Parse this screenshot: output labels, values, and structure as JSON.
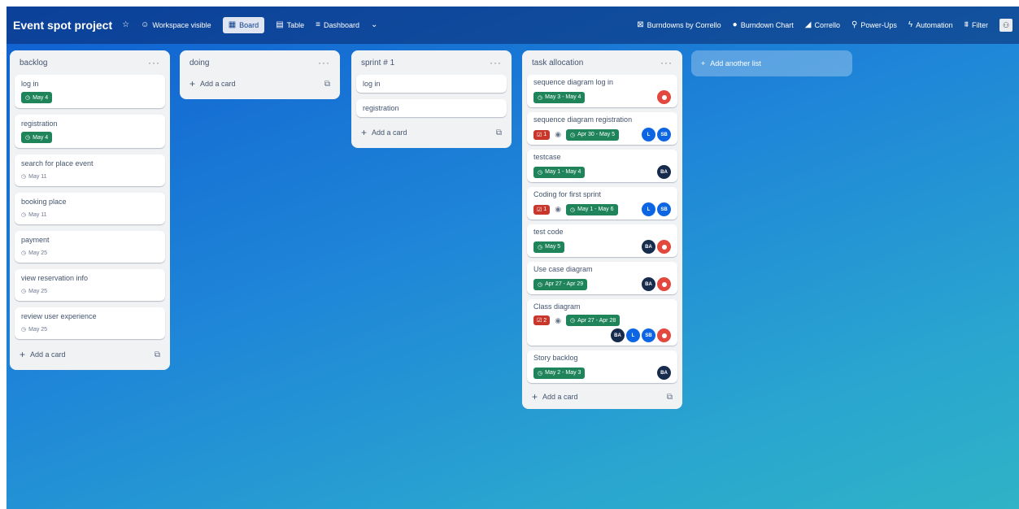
{
  "topbar": {
    "title": "Event spot project",
    "visibility": "Workspace visible",
    "views": {
      "board": "Board",
      "table": "Table",
      "dashboard": "Dashboard"
    },
    "right": {
      "burndowns": "Burndowns by Corrello",
      "burndown_chart": "Burndown Chart",
      "corrello": "Corrello",
      "powerups": "Power-Ups",
      "automation": "Automation",
      "filter": "Filter"
    }
  },
  "lists": [
    {
      "title": "backlog",
      "add_card": "Add a card",
      "cards": [
        {
          "title": "log in",
          "date": "May 4",
          "date_style": "green"
        },
        {
          "title": "registration",
          "date": "May 4",
          "date_style": "green"
        },
        {
          "title": "search for place event",
          "date": "May 11",
          "date_style": "plain"
        },
        {
          "title": "booking place",
          "date": "May 11",
          "date_style": "plain"
        },
        {
          "title": "payment",
          "date": "May 25",
          "date_style": "plain"
        },
        {
          "title": "view reservation info",
          "date": "May 25",
          "date_style": "plain"
        },
        {
          "title": "review user experience",
          "date": "May 25",
          "date_style": "plain"
        }
      ]
    },
    {
      "title": "doing",
      "add_card": "Add a card",
      "cards": []
    },
    {
      "title": "sprint # 1",
      "add_card": "Add a card",
      "cards": [
        {
          "title": "log in"
        },
        {
          "title": "registration"
        }
      ]
    },
    {
      "title": "task allocation",
      "add_card": "Add a card",
      "cards": [
        {
          "title": "sequence diagram log in",
          "date": "May 3 - May 4"
        },
        {
          "title": "sequence diagram registration",
          "checklist": "1",
          "date": "Apr 30 - May 5",
          "avatars": [
            "L",
            "SB"
          ]
        },
        {
          "title": "testcase",
          "date": "May 1 - May 4",
          "avatars": [
            "BA"
          ]
        },
        {
          "title": "Coding for first sprint",
          "checklist": "1",
          "date": "May 1 - May 6",
          "avatars": [
            "L",
            "SB"
          ]
        },
        {
          "title": "test code",
          "date": "May 5",
          "avatars": [
            "BA"
          ]
        },
        {
          "title": "Use case diagram",
          "date": "Apr 27 - Apr 29",
          "avatars": [
            "BA"
          ]
        },
        {
          "title": "Class diagram",
          "checklist": "2",
          "date": "Apr 27 - Apr 28",
          "avatars": [
            "BA",
            "L",
            "SB"
          ]
        },
        {
          "title": "Story backlog",
          "date": "May 2 - May 3",
          "avatars": [
            "BA"
          ]
        }
      ]
    }
  ],
  "add_list": "Add another list",
  "colors": {
    "date_green": "#1f845a",
    "checklist_red": "#c9372c",
    "avatar_blue": "#0c66e4",
    "avatar_dark": "#172b4d",
    "avatar_orange": "#e2483d"
  }
}
